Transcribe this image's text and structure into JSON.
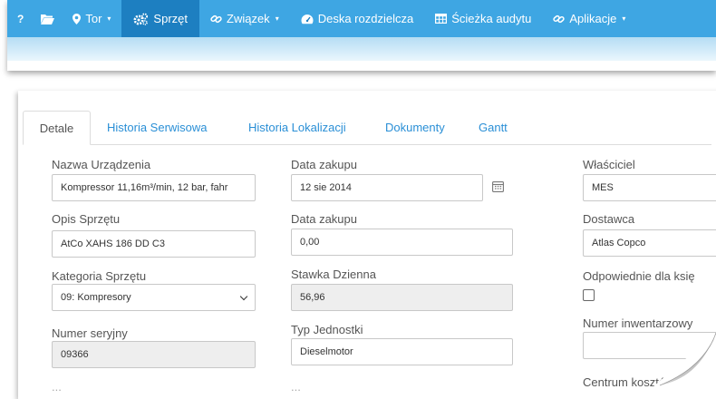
{
  "navbar": {
    "items": [
      {
        "label": "",
        "icon": "question-icon"
      },
      {
        "label": "",
        "icon": "folder-open-icon"
      },
      {
        "label": "Tor",
        "icon": "map-marker-icon",
        "dropdown": true
      },
      {
        "label": "Sprzęt",
        "icon": "cogs-icon",
        "active": true
      },
      {
        "label": "Związek",
        "icon": "link-icon",
        "dropdown": true
      },
      {
        "label": "Deska rozdzielcza",
        "icon": "dashboard-icon"
      },
      {
        "label": "Ścieżka audytu",
        "icon": "table-icon"
      },
      {
        "label": "Aplikacje",
        "icon": "link-icon",
        "dropdown": true
      }
    ],
    "question_glyph": "?",
    "caret": "▾",
    "colors": {
      "bar": "#3ea6e3",
      "active": "#1d7fc1"
    }
  },
  "tabs": [
    "Detale",
    "Historia Serwisowa",
    "Historia Lokalizacji",
    "Dokumenty",
    "Gantt"
  ],
  "form": {
    "col1": {
      "device_name_label": "Nazwa Urządzenia",
      "device_name_value": "Kompressor 11,16m³/min, 12 bar, fahr",
      "description_label": "Opis Sprzętu",
      "description_value": "AtCo  XAHS 186 DD C3",
      "category_label": "Kategoria Sprzętu",
      "category_value": "09: Kompresory",
      "serial_label": "Numer seryjny",
      "serial_value": "09366",
      "cut_label": "..."
    },
    "col2": {
      "purchase_date_label": "Data zakupu",
      "purchase_date_value": "12 sie 2014",
      "purchase_price_label": "Data zakupu",
      "purchase_price_value": "0,00",
      "daily_rate_label": "Stawka Dzienna",
      "daily_rate_value": "56,96",
      "unit_type_label": "Typ Jednostki",
      "unit_type_value": "Dieselmotor",
      "cut_label": "..."
    },
    "col3": {
      "owner_label": "Właściciel",
      "owner_value": "MES",
      "supplier_label": "Dostawca",
      "supplier_value": "Atlas Copco",
      "accounting_label": "Odpowiednie dla księ",
      "inventory_label": "Numer inwentarzowy",
      "inventory_value": "",
      "cost_center_label": "Centrum kosztó"
    }
  }
}
